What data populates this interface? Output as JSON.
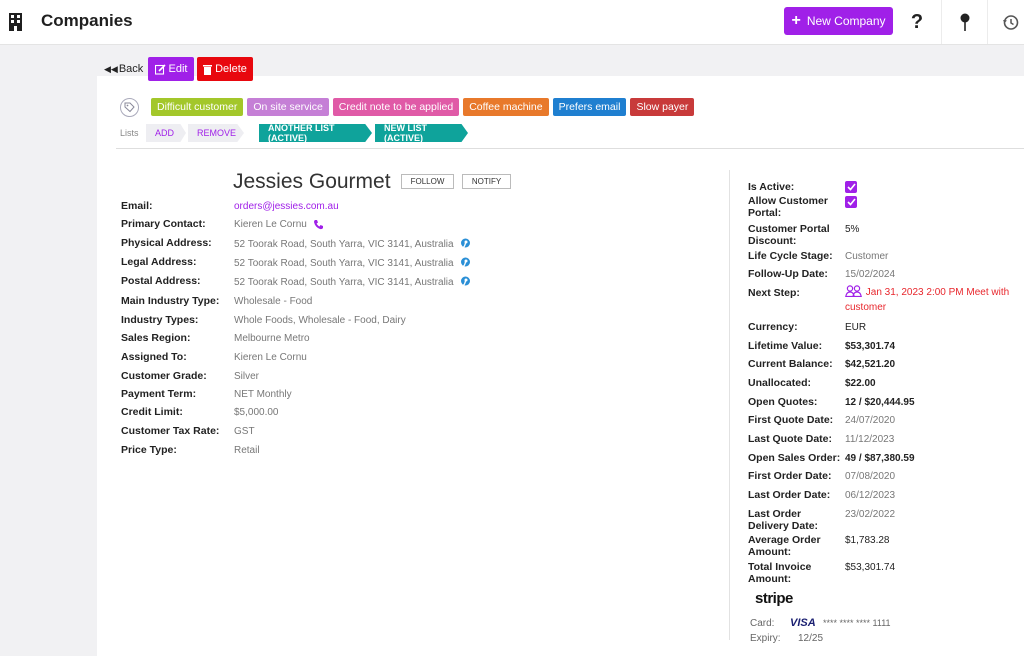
{
  "header": {
    "title": "Companies",
    "new_button_label": "New Company",
    "help_label": "?"
  },
  "toolbar": {
    "back_label": "Back",
    "edit_label": "Edit",
    "delete_label": "Delete"
  },
  "tags": [
    {
      "label": "Difficult customer",
      "color": "#a3c72a"
    },
    {
      "label": "On site service",
      "color": "#c57fd6"
    },
    {
      "label": "Credit note to be applied",
      "color": "#e05aa7"
    },
    {
      "label": "Coffee machine",
      "color": "#e8792b"
    },
    {
      "label": "Prefers email",
      "color": "#1f7fd0"
    },
    {
      "label": "Slow payer",
      "color": "#c83a3a"
    }
  ],
  "lists": {
    "label": "Lists",
    "add_label": "ADD",
    "remove_label": "REMOVE",
    "items": [
      "ANOTHER LIST (ACTIVE)",
      "NEW LIST (ACTIVE)"
    ]
  },
  "company": {
    "name": "Jessies Gourmet",
    "follow_label": "FOLLOW",
    "notify_label": "NOTIFY"
  },
  "details_left": [
    {
      "label": "Email:",
      "value": "orders@jessies.com.au"
    },
    {
      "label": "Primary Contact:",
      "value": "Kieren Le Cornu"
    },
    {
      "label": "Physical Address:",
      "value": "52 Toorak Road, South Yarra, VIC 3141, Australia"
    },
    {
      "label": "Legal Address:",
      "value": "52 Toorak Road, South Yarra, VIC 3141, Australia"
    },
    {
      "label": "Postal Address:",
      "value": "52 Toorak Road, South Yarra, VIC 3141, Australia"
    },
    {
      "label": "Main Industry Type:",
      "value": "Wholesale - Food"
    },
    {
      "label": "Industry Types:",
      "value": "Whole Foods, Wholesale - Food, Dairy"
    },
    {
      "label": "Sales Region:",
      "value": "Melbourne Metro"
    },
    {
      "label": "Assigned To:",
      "value": "Kieren Le Cornu"
    },
    {
      "label": "Customer Grade:",
      "value": "Silver"
    },
    {
      "label": "Payment Term:",
      "value": "NET Monthly"
    },
    {
      "label": "Credit Limit:",
      "value": "$5,000.00"
    },
    {
      "label": "Customer Tax Rate:",
      "value": "GST"
    },
    {
      "label": "Price Type:",
      "value": "Retail"
    }
  ],
  "details_right": {
    "is_active_label": "Is Active:",
    "is_active_checked": true,
    "portal_label": "Allow Customer Portal:",
    "portal_checked": true,
    "portal_discount_label": "Customer Portal Discount:",
    "portal_discount": "5%",
    "life_cycle_label": "Life Cycle Stage:",
    "life_cycle": "Customer",
    "follow_up_label": "Follow-Up Date:",
    "follow_up": "15/02/2024",
    "next_step_label": "Next Step:",
    "next_step": "Jan 31, 2023 2:00 PM Meet with customer",
    "currency_label": "Currency:",
    "currency": "EUR",
    "lifetime_label": "Lifetime Value:",
    "lifetime": "$53,301.74",
    "balance_label": "Current Balance:",
    "balance": "$42,521.20",
    "unallocated_label": "Unallocated:",
    "unallocated": "$22.00",
    "open_quotes_label": "Open Quotes:",
    "open_quotes": "12 / $20,444.95",
    "first_quote_label": "First Quote Date:",
    "first_quote": "24/07/2020",
    "last_quote_label": "Last Quote Date:",
    "last_quote": "11/12/2023",
    "open_sales_label": "Open Sales Order:",
    "open_sales": "49 / $87,380.59",
    "first_order_label": "First Order Date:",
    "first_order": "07/08/2020",
    "last_order_label": "Last Order Date:",
    "last_order": "06/12/2023",
    "last_delivery_label": "Last Order Delivery Date:",
    "last_delivery": "23/02/2022",
    "avg_order_label": "Average Order Amount:",
    "avg_order": "$1,783.28",
    "total_invoice_label": "Total Invoice Amount:",
    "total_invoice": "$53,301.74"
  },
  "payment": {
    "provider": "stripe",
    "card_label": "Card:",
    "card_brand": "VISA",
    "card_number": "**** **** **** 1111",
    "expiry_label": "Expiry:",
    "expiry": "12/25"
  }
}
